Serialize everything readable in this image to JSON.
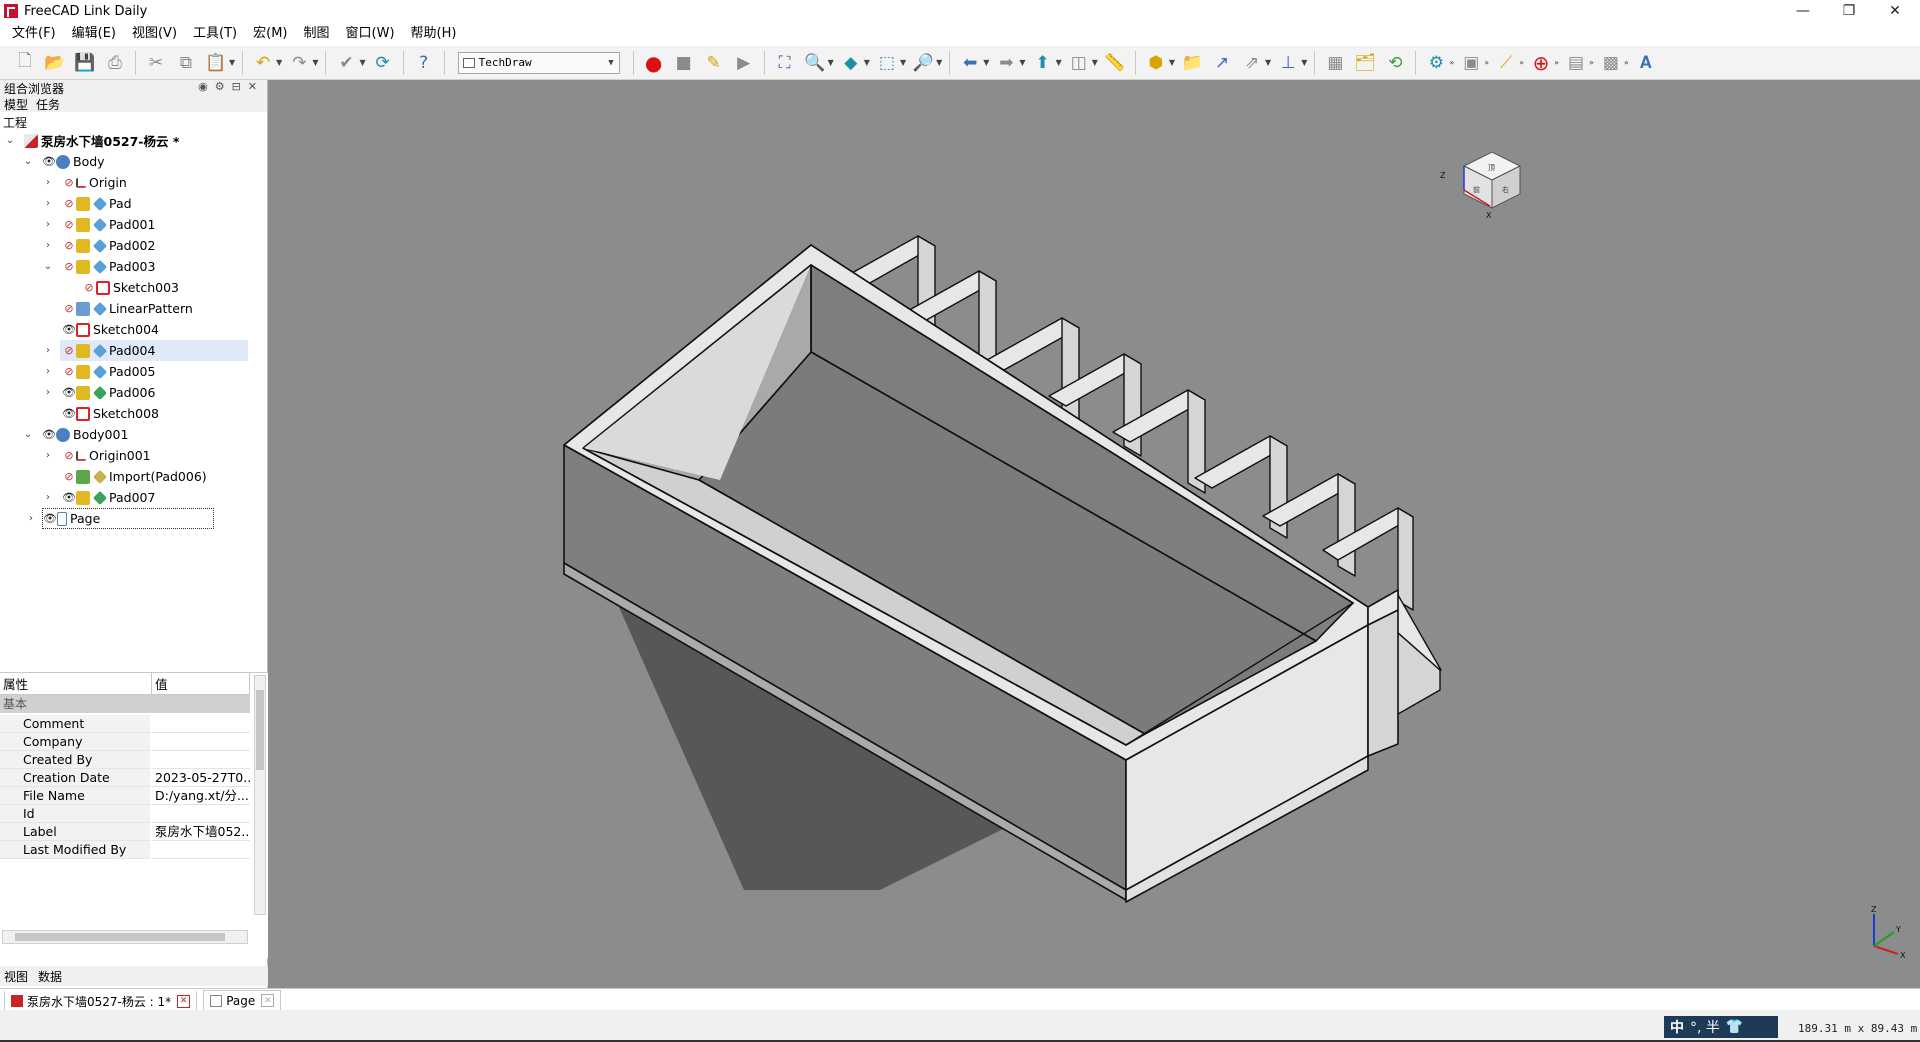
{
  "window": {
    "title": "FreeCAD Link Daily",
    "controls": {
      "minimize": "—",
      "restore": "❐",
      "close": "✕"
    }
  },
  "menu": [
    "文件(F)",
    "编辑(E)",
    "视图(V)",
    "工具(T)",
    "宏(M)",
    "制图",
    "窗口(W)",
    "帮助(H)"
  ],
  "toolbar": {
    "workbench": "TechDraw"
  },
  "combo_view": {
    "title": "组合浏览器",
    "tabs_top": [
      "模型",
      "任务"
    ],
    "section_label": "工程",
    "tree": [
      {
        "label": "泵房水下墙0527-杨云 *",
        "icon": "document-icon",
        "bold": true
      },
      {
        "label": "Body",
        "icon": "body-icon"
      },
      {
        "label": "Origin",
        "icon": "origin-icon"
      },
      {
        "label": "Pad",
        "icon": "pad-icon"
      },
      {
        "label": "Pad001",
        "icon": "pad-icon"
      },
      {
        "label": "Pad002",
        "icon": "pad-icon"
      },
      {
        "label": "Pad003",
        "icon": "pad-icon"
      },
      {
        "label": "Sketch003",
        "icon": "sketch-icon"
      },
      {
        "label": "LinearPattern",
        "icon": "pattern-icon"
      },
      {
        "label": "Sketch004",
        "icon": "sketch-icon"
      },
      {
        "label": "Pad004",
        "icon": "pad-icon"
      },
      {
        "label": "Pad005",
        "icon": "pad-icon"
      },
      {
        "label": "Pad006",
        "icon": "pad-icon"
      },
      {
        "label": "Sketch008",
        "icon": "sketch-icon"
      },
      {
        "label": "Body001",
        "icon": "body-icon"
      },
      {
        "label": "Origin001",
        "icon": "origin-icon"
      },
      {
        "label": "Import(Pad006)",
        "icon": "import-icon"
      },
      {
        "label": "Pad007",
        "icon": "pad-icon"
      },
      {
        "label": "Page",
        "icon": "page-icon"
      }
    ],
    "tabs_bottom": [
      "视图",
      "数据"
    ]
  },
  "properties": {
    "header_property": "属性",
    "header_value": "值",
    "group": "基本",
    "rows": [
      {
        "key": "Comment",
        "value": ""
      },
      {
        "key": "Company",
        "value": ""
      },
      {
        "key": "Created By",
        "value": ""
      },
      {
        "key": "Creation Date",
        "value": "2023-05-27T0..."
      },
      {
        "key": "File Name",
        "value": "D:/yang.xt/分..."
      },
      {
        "key": "Id",
        "value": ""
      },
      {
        "key": "Label",
        "value": "泵房水下墙052..."
      },
      {
        "key": "Last Modified By",
        "value": ""
      }
    ]
  },
  "nav_cube": {
    "top": "顶",
    "front": "前",
    "right": "右",
    "axis_x": "X",
    "axis_z": "Z"
  },
  "axis_indicator": {
    "x": "X",
    "y": "Y",
    "z": "Z"
  },
  "doc_tabs": [
    {
      "label": "泵房水下墙0527-杨云 : 1*"
    },
    {
      "label": "Page"
    }
  ],
  "status": {
    "ime": "中",
    "ime_extra": "°, 半",
    "dimensions": "189.31 m x 89.43 m"
  },
  "colors": {
    "viewport_bg": "#8a8c8e",
    "model_light": "#e6e7e8",
    "model_mid": "#d4d5d6",
    "model_dark": "#7d7e80",
    "shadow": "#565759"
  }
}
